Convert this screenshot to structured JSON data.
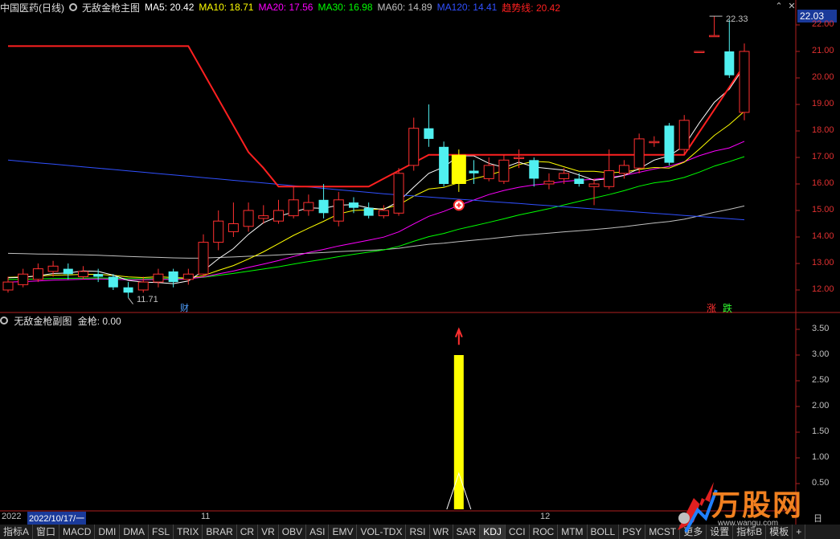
{
  "header": {
    "stock": "中国医药(日线)",
    "indicator": "无敌金枪主图",
    "ma5": "MA5: 20.42",
    "ma10": "MA10: 18.71",
    "ma20": "MA20: 17.56",
    "ma30": "MA30: 16.98",
    "ma60": "MA60: 14.89",
    "ma120": "MA120: 14.41",
    "trend": "趋势线: 20.42"
  },
  "colors": {
    "ma5": "#ffffff",
    "ma10": "#ffff00",
    "ma20": "#ff00ff",
    "ma30": "#00ff00",
    "ma60": "#c0c0c0",
    "ma120": "#3050ff",
    "trend": "#ff2020",
    "up": "#ff3030",
    "down": "#50f0f0",
    "signal": "#ffff00"
  },
  "price_box": "22.03",
  "price_axis": [
    "22.00",
    "21.00",
    "20.00",
    "19.00",
    "18.00",
    "17.00",
    "16.00",
    "15.00",
    "14.00",
    "13.00",
    "12.00"
  ],
  "sub_axis": [
    "3.50",
    "3.00",
    "2.50",
    "2.00",
    "1.50",
    "1.00",
    "0.50"
  ],
  "annotations": {
    "high": "22.33",
    "low": "11.71",
    "cai": "财",
    "zhang": "涨",
    "die": "跌"
  },
  "sub_header": {
    "indicator": "无敌金枪副图",
    "value": "金枪: 0.00"
  },
  "date_strip": {
    "year": "2022",
    "date": "2022/10/17/一",
    "m11": "11",
    "m12": "12",
    "period": "日线"
  },
  "tabs": [
    "指标A",
    "窗口",
    "MACD",
    "DMI",
    "DMA",
    "FSL",
    "TRIX",
    "BRAR",
    "CR",
    "VR",
    "OBV",
    "ASI",
    "EMV",
    "VOL-TDX",
    "RSI",
    "WR",
    "SAR",
    "KDJ",
    "CCI",
    "ROC",
    "MTM",
    "BOLL",
    "PSY",
    "MCST",
    "更多",
    "设置",
    "指标B",
    "模板",
    "+"
  ],
  "watermark": {
    "text": "万股网",
    "url": "www.wangu.com"
  },
  "chart_data": {
    "type": "candlestick",
    "ylim": [
      11.5,
      22.4
    ],
    "candles": [
      {
        "o": 12.0,
        "c": 12.3,
        "h": 12.5,
        "l": 11.9
      },
      {
        "o": 12.2,
        "c": 12.6,
        "h": 12.8,
        "l": 12.1
      },
      {
        "o": 12.4,
        "c": 12.8,
        "h": 13.0,
        "l": 12.3
      },
      {
        "o": 12.7,
        "c": 12.9,
        "h": 13.1,
        "l": 12.5
      },
      {
        "o": 12.8,
        "c": 12.6,
        "h": 13.0,
        "l": 12.4
      },
      {
        "o": 12.5,
        "c": 12.7,
        "h": 12.9,
        "l": 12.4
      },
      {
        "o": 12.6,
        "c": 12.5,
        "h": 12.8,
        "l": 12.3
      },
      {
        "o": 12.5,
        "c": 12.1,
        "h": 12.6,
        "l": 12.0
      },
      {
        "o": 12.1,
        "c": 11.9,
        "h": 12.3,
        "l": 11.71
      },
      {
        "o": 12.0,
        "c": 12.3,
        "h": 12.5,
        "l": 11.9
      },
      {
        "o": 12.3,
        "c": 12.6,
        "h": 12.8,
        "l": 12.1
      },
      {
        "o": 12.7,
        "c": 12.3,
        "h": 12.8,
        "l": 12.1
      },
      {
        "o": 12.4,
        "c": 12.6,
        "h": 12.8,
        "l": 12.2
      },
      {
        "o": 12.6,
        "c": 13.8,
        "h": 14.1,
        "l": 12.5
      },
      {
        "o": 13.8,
        "c": 14.6,
        "h": 15.0,
        "l": 13.5
      },
      {
        "o": 14.2,
        "c": 14.5,
        "h": 15.3,
        "l": 14.0
      },
      {
        "o": 14.4,
        "c": 15.0,
        "h": 15.3,
        "l": 14.2
      },
      {
        "o": 14.7,
        "c": 14.8,
        "h": 15.2,
        "l": 14.5
      },
      {
        "o": 14.6,
        "c": 15.0,
        "h": 15.4,
        "l": 14.5
      },
      {
        "o": 14.8,
        "c": 15.4,
        "h": 15.9,
        "l": 14.7
      },
      {
        "o": 15.0,
        "c": 15.3,
        "h": 15.6,
        "l": 14.8
      },
      {
        "o": 15.4,
        "c": 14.9,
        "h": 16.0,
        "l": 14.7
      },
      {
        "o": 14.6,
        "c": 15.4,
        "h": 15.7,
        "l": 14.4
      },
      {
        "o": 15.3,
        "c": 15.1,
        "h": 15.5,
        "l": 14.9
      },
      {
        "o": 15.1,
        "c": 14.8,
        "h": 15.3,
        "l": 14.7
      },
      {
        "o": 14.8,
        "c": 15.0,
        "h": 15.2,
        "l": 14.7
      },
      {
        "o": 14.9,
        "c": 16.4,
        "h": 16.6,
        "l": 14.8
      },
      {
        "o": 16.7,
        "c": 18.1,
        "h": 18.5,
        "l": 16.5
      },
      {
        "o": 18.1,
        "c": 17.7,
        "h": 19.0,
        "l": 17.4
      },
      {
        "o": 17.4,
        "c": 16.0,
        "h": 17.6,
        "l": 15.9
      },
      {
        "o": 16.0,
        "c": 17.1,
        "h": 17.3,
        "l": 15.7
      },
      {
        "o": 16.5,
        "c": 16.4,
        "h": 16.9,
        "l": 16.0
      },
      {
        "o": 16.2,
        "c": 16.7,
        "h": 17.0,
        "l": 16.1
      },
      {
        "o": 16.1,
        "c": 16.9,
        "h": 17.1,
        "l": 16.0
      },
      {
        "o": 17.0,
        "c": 17.0,
        "h": 17.3,
        "l": 16.6
      },
      {
        "o": 16.9,
        "c": 16.2,
        "h": 17.0,
        "l": 15.9
      },
      {
        "o": 16.0,
        "c": 16.1,
        "h": 16.4,
        "l": 15.8
      },
      {
        "o": 16.2,
        "c": 16.4,
        "h": 16.6,
        "l": 16.0
      },
      {
        "o": 16.2,
        "c": 16.0,
        "h": 16.4,
        "l": 15.9
      },
      {
        "o": 15.9,
        "c": 16.0,
        "h": 16.2,
        "l": 15.2
      },
      {
        "o": 15.9,
        "c": 16.5,
        "h": 17.3,
        "l": 15.8
      },
      {
        "o": 16.4,
        "c": 16.7,
        "h": 16.9,
        "l": 16.2
      },
      {
        "o": 16.6,
        "c": 17.7,
        "h": 17.9,
        "l": 16.4
      },
      {
        "o": 17.6,
        "c": 17.6,
        "h": 17.8,
        "l": 17.4
      },
      {
        "o": 18.2,
        "c": 16.8,
        "h": 18.3,
        "l": 16.7
      },
      {
        "o": 17.3,
        "c": 18.4,
        "h": 18.6,
        "l": 17.1
      },
      {
        "o": 21.0,
        "c": 21.0,
        "h": 21.0,
        "l": 21.0
      },
      {
        "o": 21.6,
        "c": 21.6,
        "h": 22.33,
        "l": 21.6
      },
      {
        "o": 21.0,
        "c": 20.1,
        "h": 22.2,
        "l": 20.0
      },
      {
        "o": 18.7,
        "c": 21.0,
        "h": 21.3,
        "l": 18.4
      }
    ],
    "signal_index": 30,
    "gold_gun": {
      "value": 3.0,
      "index": 30
    }
  }
}
